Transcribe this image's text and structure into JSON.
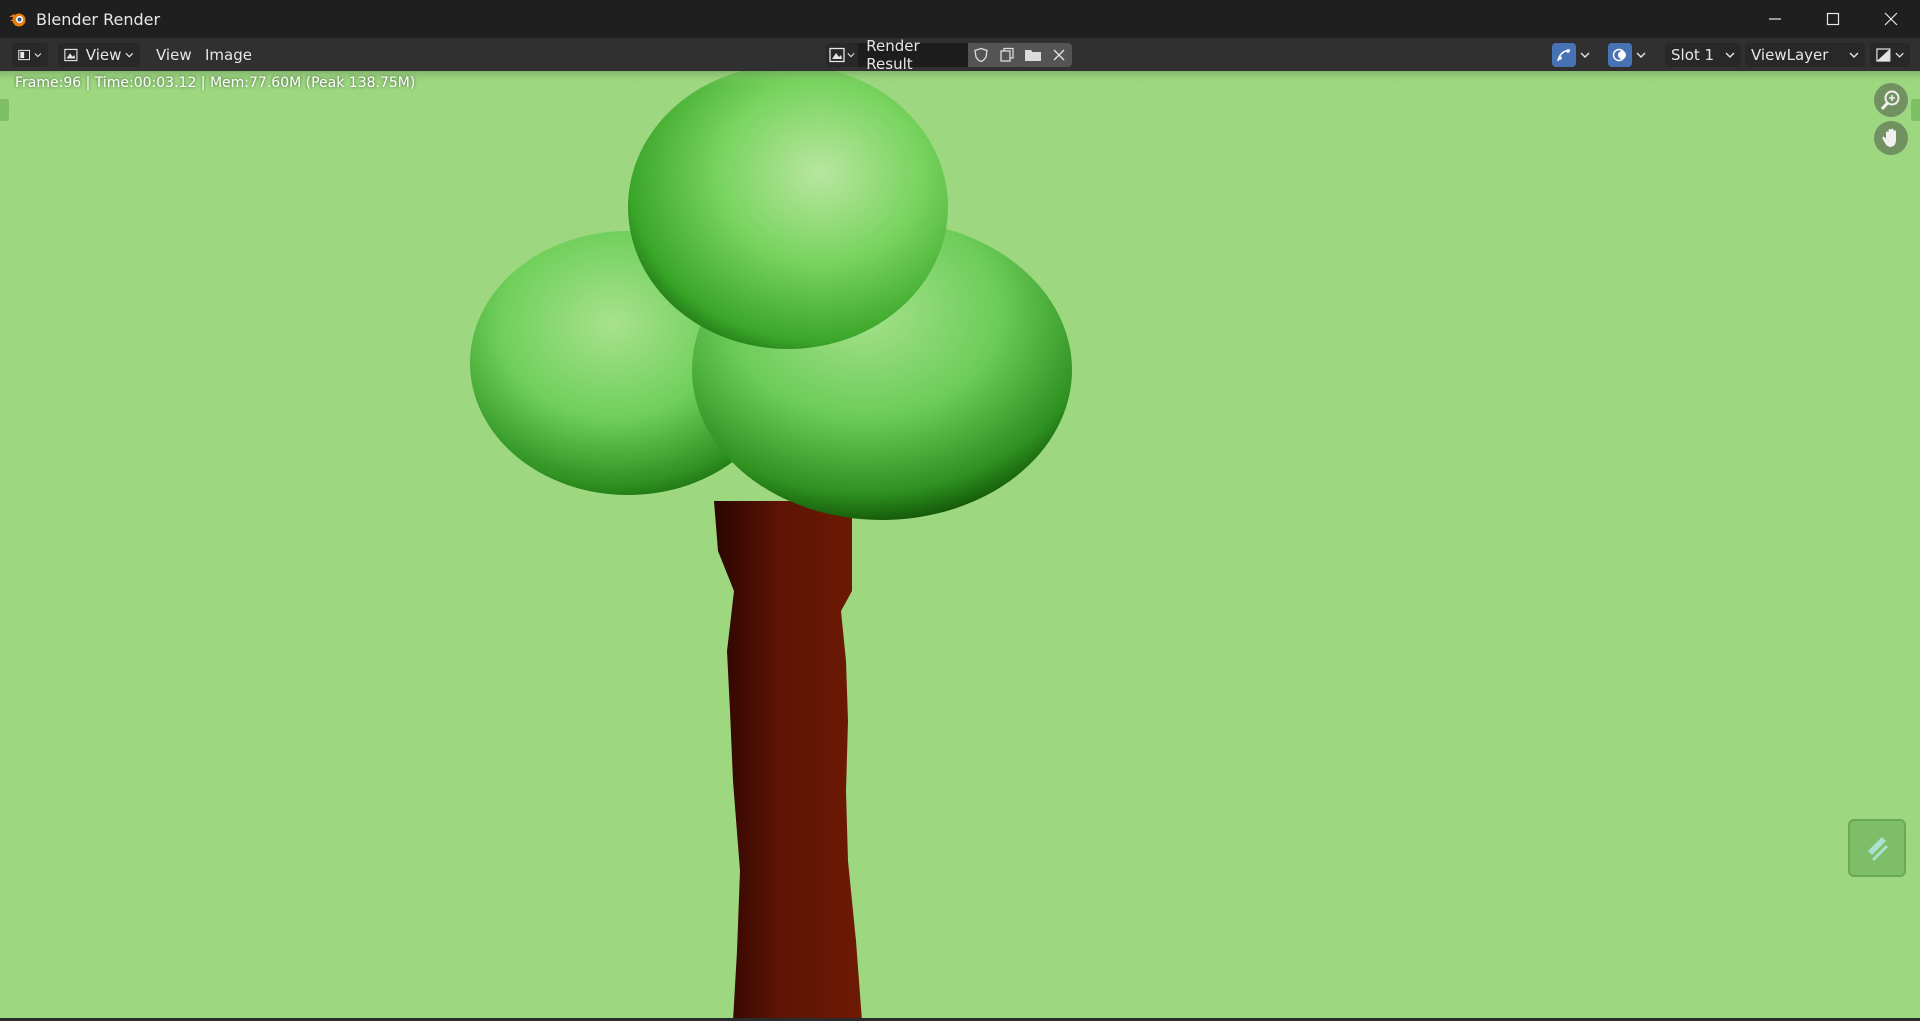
{
  "window": {
    "title": "Blender Render",
    "logo_icon": "blender-logo-icon",
    "controls": [
      "minimize-icon",
      "maximize-icon",
      "close-icon"
    ]
  },
  "header": {
    "editor_type_icon": "image-editor-icon",
    "view_mode_label": "View",
    "menus": [
      "View",
      "Image"
    ],
    "image": {
      "type_icon": "image-browse-icon",
      "name": "Render Result",
      "tools": [
        "fake-user-shield-icon",
        "duplicate-icon",
        "open-folder-icon",
        "close-icon"
      ]
    },
    "gizmo_toggle_icon": "gizmo-icon",
    "overlay_toggle_icon": "overlay-icon",
    "slot_label": "Slot 1",
    "view_layer_label": "ViewLayer",
    "display_channels_icon": "display-channels-icon",
    "accent_color": "#4772b3"
  },
  "viewport": {
    "stats_text": "Frame:96 | Time:00:03.12 | Mem:77.60M (Peak 138.75M)",
    "background_color": "#9dd880",
    "foliage_color": "#6fcf5a",
    "trunk_color": "#5e1405",
    "zoom_icon": "zoom-icon",
    "pan_icon": "pan-hand-icon",
    "floating_tool_icon": "tool-icon"
  }
}
